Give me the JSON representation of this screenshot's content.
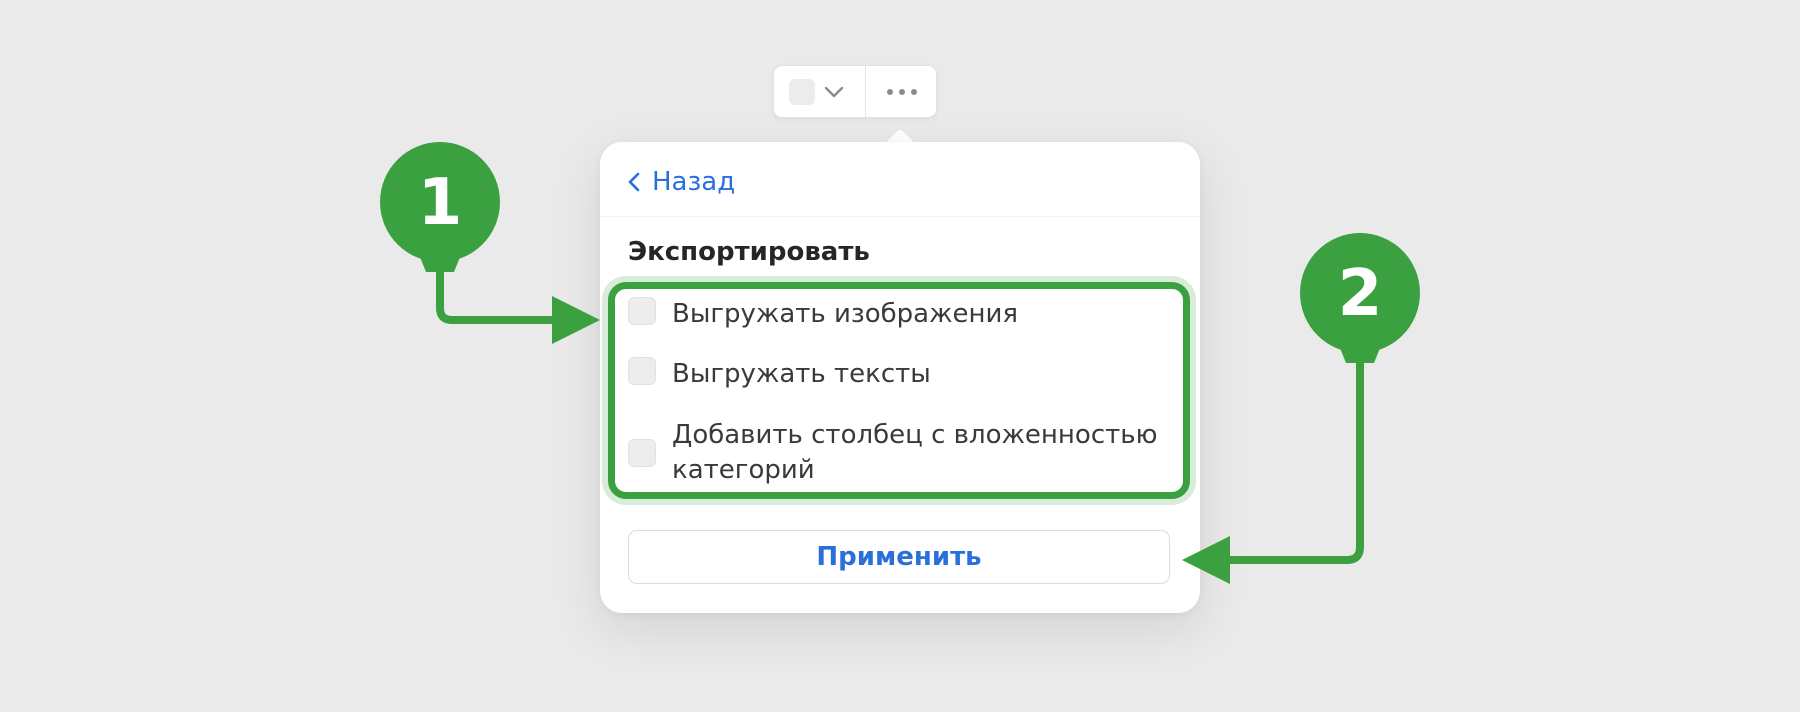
{
  "toolbar": {
    "checkbox_icon": "checkbox-square-icon",
    "chevron_icon": "chevron-down-icon",
    "more_icon": "more-dots-icon"
  },
  "popover": {
    "back_label": "Назад",
    "section_title": "Экспортировать",
    "options": [
      {
        "label": "Выгружать изображения",
        "checked": false
      },
      {
        "label": "Выгружать тексты",
        "checked": false
      },
      {
        "label": "Добавить столбец с вложенностью категорий",
        "checked": false
      }
    ],
    "apply_label": "Применить"
  },
  "annotations": {
    "marker_1": "1",
    "marker_2": "2",
    "color": "#3aa040"
  },
  "colors": {
    "background": "#eaeaea",
    "link": "#2a6fdc",
    "accent": "#3aa040"
  }
}
